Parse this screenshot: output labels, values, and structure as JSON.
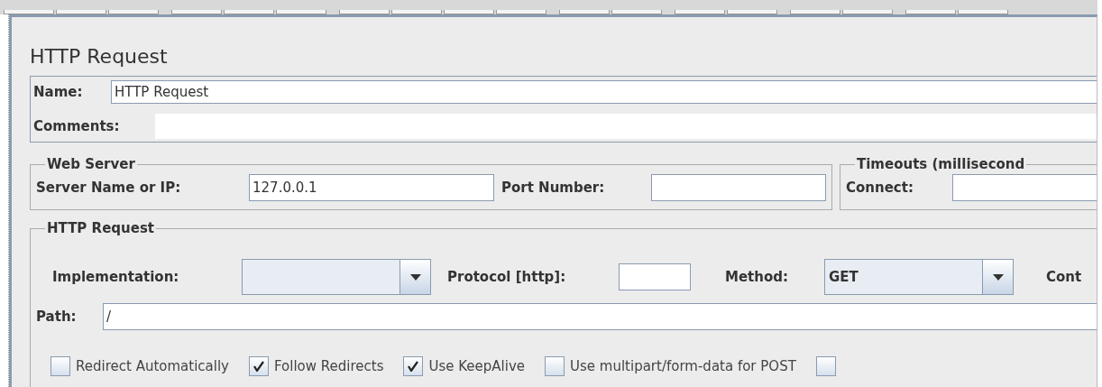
{
  "title": "HTTP Request",
  "name_field": {
    "label": "Name:",
    "value": "HTTP Request"
  },
  "comments_field": {
    "label": "Comments:"
  },
  "web_server": {
    "legend": "Web Server",
    "server_label": "Server Name or IP:",
    "server_value": "127.0.0.1",
    "port_label": "Port Number:"
  },
  "timeouts": {
    "legend": "Timeouts (millisecond",
    "connect_label": "Connect:"
  },
  "http_request": {
    "legend": "HTTP Request",
    "implementation_label": "Implementation:",
    "protocol_label": "Protocol [http]:",
    "method_label": "Method:",
    "method_value": "GET",
    "content_label": "Cont",
    "path_label": "Path:",
    "path_value": "/",
    "options": [
      {
        "label": "Redirect Automatically",
        "checked": false
      },
      {
        "label": "Follow Redirects",
        "checked": true
      },
      {
        "label": "Use KeepAlive",
        "checked": true
      },
      {
        "label": "Use multipart/form-data for POST",
        "checked": false
      },
      {
        "checked": false
      }
    ]
  }
}
